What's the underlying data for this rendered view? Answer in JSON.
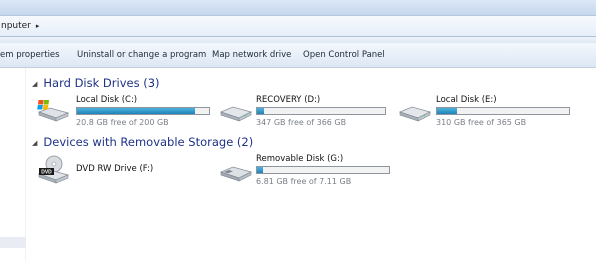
{
  "address": {
    "crumb": "nputer",
    "chevron": "▸"
  },
  "toolbar": {
    "items": [
      "em properties",
      "Uninstall or change a program",
      "Map network drive",
      "Open Control Panel"
    ]
  },
  "groups": {
    "hard_disks": {
      "arrow": "◢",
      "label": "Hard Disk Drives (3)"
    },
    "removable": {
      "arrow": "◢",
      "label": "Devices with Removable Storage (2)"
    }
  },
  "drives": [
    {
      "name": "Local Disk (C:)",
      "free_text": "20.8 GB free of 200 GB",
      "used_fraction": 0.896,
      "icon": "windows-disk-icon"
    },
    {
      "name": "RECOVERY (D:)",
      "free_text": "347 GB free of 366 GB",
      "used_fraction": 0.052,
      "icon": "hard-disk-icon"
    },
    {
      "name": "Local Disk (E:)",
      "free_text": "310 GB free of 365 GB",
      "used_fraction": 0.151,
      "icon": "hard-disk-icon"
    },
    {
      "name": "DVD RW Drive (F:)",
      "icon": "dvd-drive-icon",
      "icon_text": "DVD"
    },
    {
      "name": "Removable Disk (G:)",
      "free_text": "6.81 GB free of 7.11 GB",
      "used_fraction": 0.042,
      "icon": "usb-drive-icon"
    }
  ],
  "colors": {
    "group_header": "#1e3287",
    "bar_fill": "#2a92c5",
    "free_text": "#7a7f87"
  }
}
